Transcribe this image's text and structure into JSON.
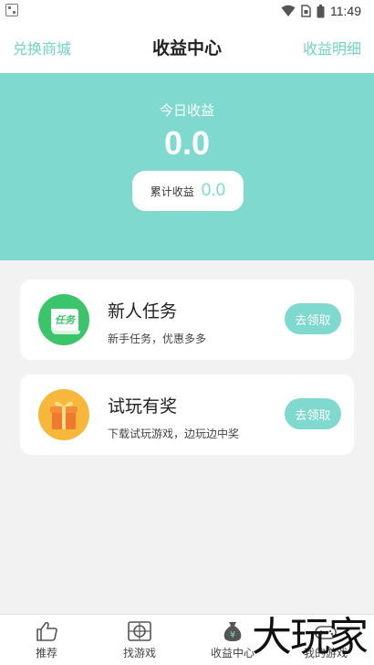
{
  "status_bar": {
    "time": "11:49",
    "icons": [
      "qr-code-icon",
      "wifi-icon",
      "sim-icon",
      "battery-icon"
    ]
  },
  "header": {
    "left_link": "兑换商城",
    "title": "收益中心",
    "right_link": "收益明细"
  },
  "summary": {
    "today_label": "今日收益",
    "today_value": "0.0",
    "total_label": "累计收益",
    "total_value": "0.0"
  },
  "tasks": [
    {
      "icon": "task-scroll-icon",
      "icon_text": "任务",
      "title": "新人任务",
      "subtitle": "新手任务，优惠多多",
      "button": "去领取"
    },
    {
      "icon": "gift-box-icon",
      "title": "试玩有奖",
      "subtitle": "下载试玩游戏，边玩边中奖",
      "button": "去领取"
    }
  ],
  "bottom_nav": [
    {
      "label": "推荐",
      "icon": "thumbs-up-icon"
    },
    {
      "label": "找游戏",
      "icon": "target-icon"
    },
    {
      "label": "收益中心",
      "icon": "money-bag-icon",
      "icon_text": "¥"
    },
    {
      "label": "我的游戏",
      "icon": "controller-icon"
    }
  ],
  "watermark": "大玩家",
  "colors": {
    "accent": "#7fd9ce",
    "link": "#6fd3c6",
    "background": "#f2f2f2"
  }
}
